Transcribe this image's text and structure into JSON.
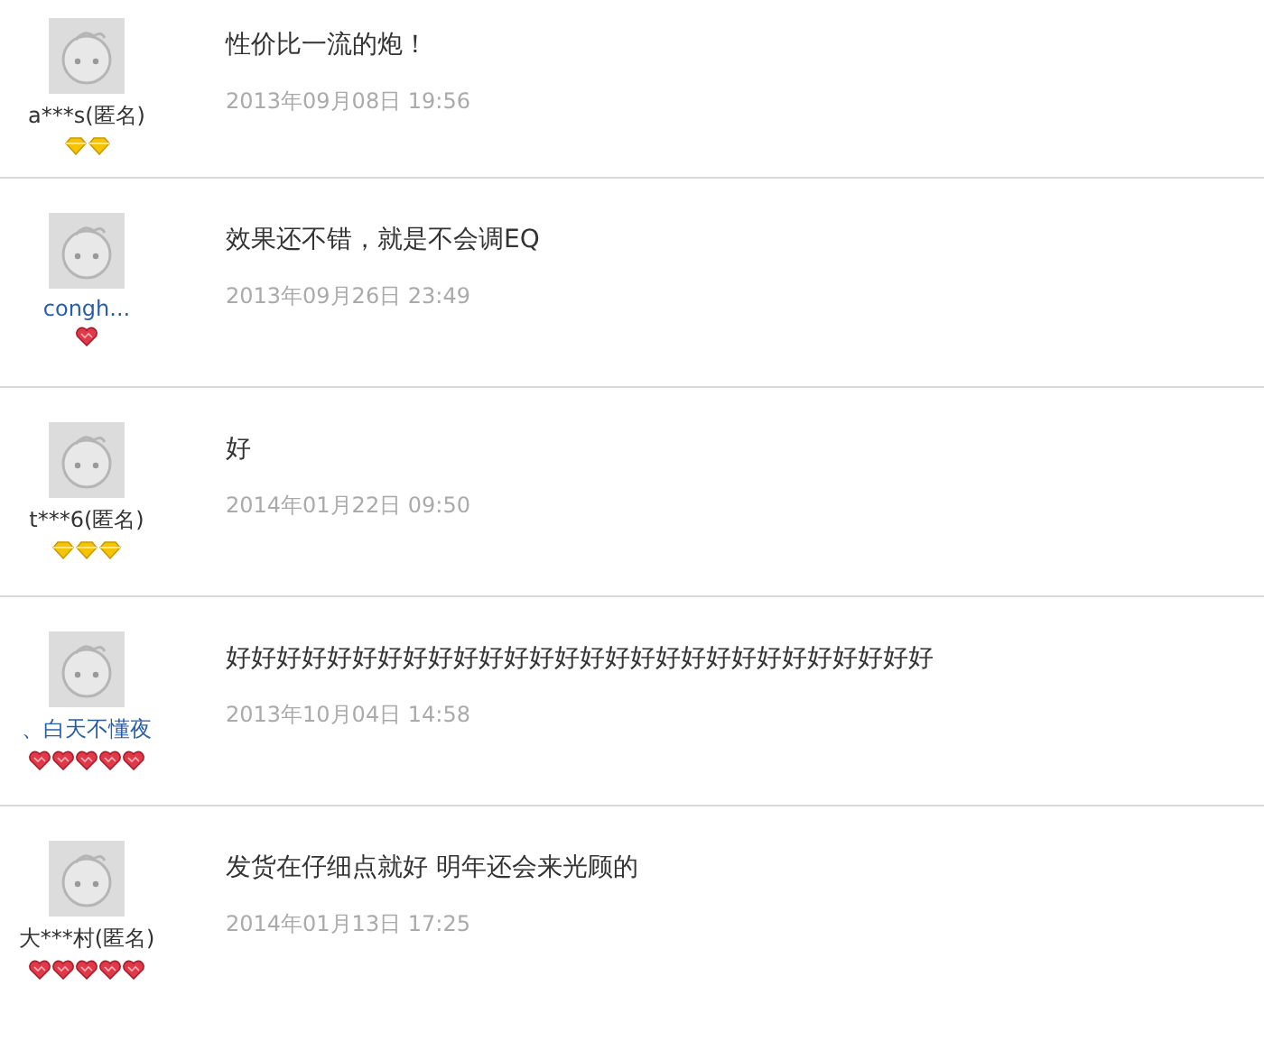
{
  "reviews": [
    {
      "user": "a***s(匿名)",
      "linked": false,
      "badges": [
        {
          "kind": "diamond"
        },
        {
          "kind": "diamond"
        }
      ],
      "comment": "性价比一流的炮！",
      "date": "2013年09月08日 19:56"
    },
    {
      "user": "congh...",
      "linked": true,
      "badges": [
        {
          "kind": "heart"
        }
      ],
      "comment": "效果还不错，就是不会调EQ",
      "date": "2013年09月26日 23:49"
    },
    {
      "user": "t***6(匿名)",
      "linked": false,
      "badges": [
        {
          "kind": "diamond"
        },
        {
          "kind": "diamond"
        },
        {
          "kind": "diamond"
        }
      ],
      "comment": "好",
      "date": "2014年01月22日 09:50"
    },
    {
      "user": "、白天不懂夜",
      "linked": true,
      "badges": [
        {
          "kind": "heart"
        },
        {
          "kind": "heart"
        },
        {
          "kind": "heart"
        },
        {
          "kind": "heart"
        },
        {
          "kind": "heart"
        }
      ],
      "comment": "好好好好好好好好好好好好好好好好好好好好好好好好好好好好",
      "date": "2013年10月04日 14:58"
    },
    {
      "user": "大***村(匿名)",
      "linked": false,
      "badges": [
        {
          "kind": "heart"
        },
        {
          "kind": "heart"
        },
        {
          "kind": "heart"
        },
        {
          "kind": "heart"
        },
        {
          "kind": "heart"
        }
      ],
      "comment": "发货在仔细点就好 明年还会来光顾的",
      "date": "2014年01月13日 17:25"
    }
  ]
}
